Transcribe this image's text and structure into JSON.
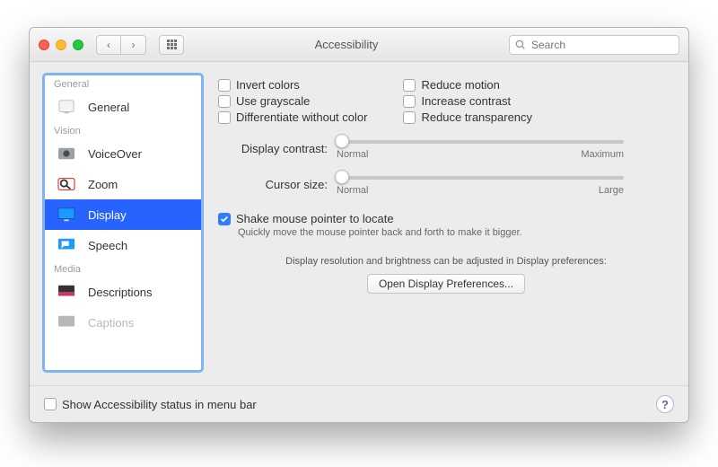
{
  "titlebar": {
    "title": "Accessibility",
    "search_placeholder": "Search"
  },
  "sidebar": {
    "sections": [
      {
        "label": "General",
        "items": [
          {
            "label": "General",
            "icon": "general"
          }
        ]
      },
      {
        "label": "Vision",
        "items": [
          {
            "label": "VoiceOver",
            "icon": "voiceover"
          },
          {
            "label": "Zoom",
            "icon": "zoom"
          },
          {
            "label": "Display",
            "icon": "display",
            "selected": true
          },
          {
            "label": "Speech",
            "icon": "speech"
          }
        ]
      },
      {
        "label": "Media",
        "items": [
          {
            "label": "Descriptions",
            "icon": "descriptions"
          },
          {
            "label": "Captions",
            "icon": "captions"
          }
        ]
      }
    ]
  },
  "main": {
    "checks_left": [
      {
        "label": "Invert colors",
        "checked": false
      },
      {
        "label": "Use grayscale",
        "checked": false
      },
      {
        "label": "Differentiate without color",
        "checked": false
      }
    ],
    "checks_right": [
      {
        "label": "Reduce motion",
        "checked": false
      },
      {
        "label": "Increase contrast",
        "checked": false
      },
      {
        "label": "Reduce transparency",
        "checked": false
      }
    ],
    "contrast": {
      "label": "Display contrast:",
      "min_label": "Normal",
      "max_label": "Maximum"
    },
    "cursor": {
      "label": "Cursor size:",
      "min_label": "Normal",
      "max_label": "Large"
    },
    "shake": {
      "label": "Shake mouse pointer to locate",
      "checked": true,
      "desc": "Quickly move the mouse pointer back and forth to make it bigger."
    },
    "hint": "Display resolution and brightness can be adjusted in Display preferences:",
    "open_btn": "Open Display Preferences..."
  },
  "footer": {
    "status_label": "Show Accessibility status in menu bar",
    "status_checked": false
  }
}
